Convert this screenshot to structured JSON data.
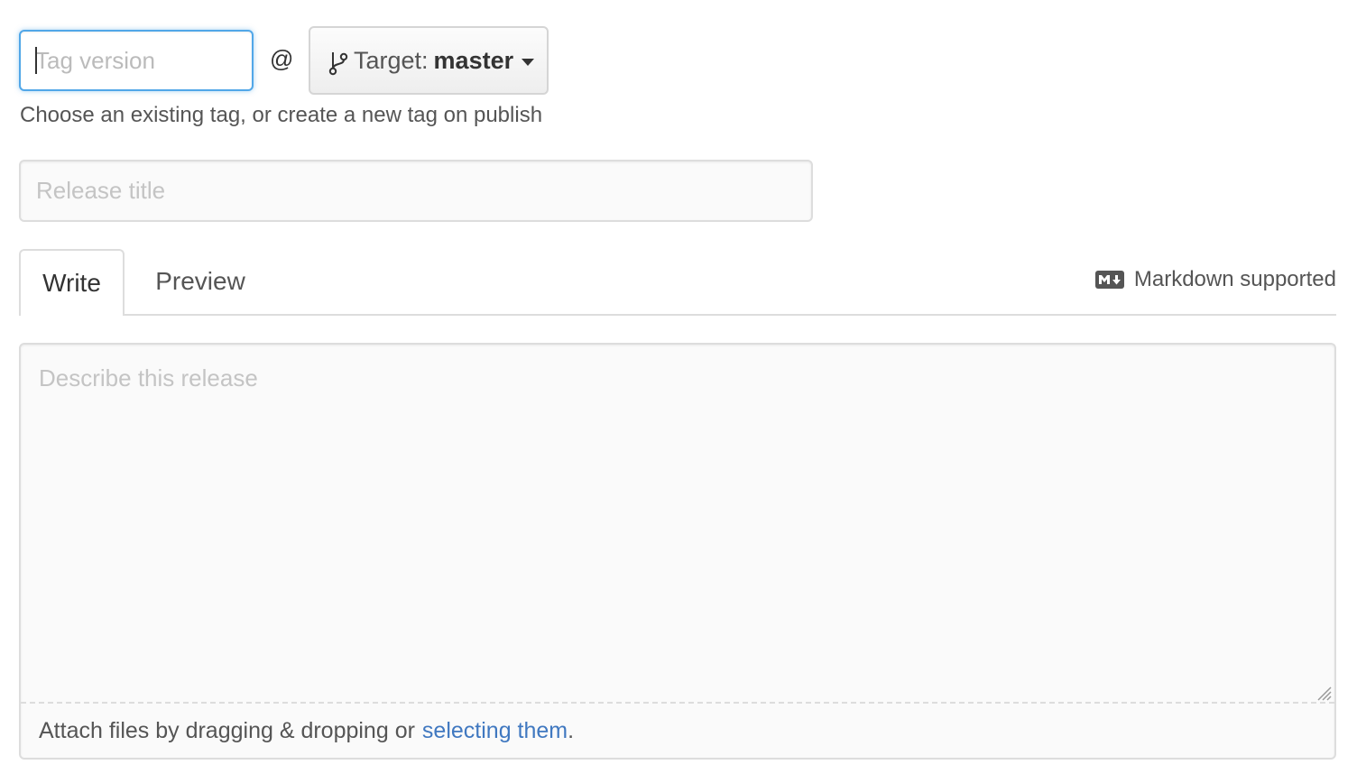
{
  "tag": {
    "placeholder": "Tag version",
    "value": "",
    "at_symbol": "@",
    "target_prefix": "Target:",
    "target_branch": "master",
    "hint": "Choose an existing tag, or create a new tag on publish"
  },
  "release_title": {
    "placeholder": "Release title",
    "value": ""
  },
  "tabs": [
    {
      "label": "Write",
      "active": true
    },
    {
      "label": "Preview",
      "active": false
    }
  ],
  "markdown_note": "Markdown supported",
  "description": {
    "placeholder": "Describe this release",
    "value": ""
  },
  "attach": {
    "text": "Attach files by dragging & dropping or",
    "link": "selecting them",
    "suffix": "."
  },
  "colors": {
    "focus_border": "#51a7e8",
    "link": "#4078c0",
    "border": "#dddddd"
  },
  "icons": [
    "git-branch-icon",
    "chevron-down-icon",
    "markdown-icon",
    "resize-handle-icon"
  ]
}
